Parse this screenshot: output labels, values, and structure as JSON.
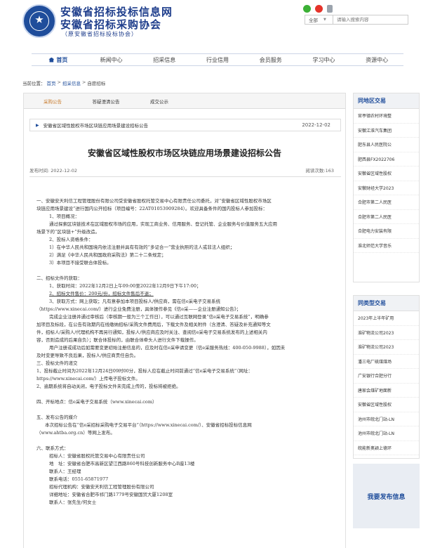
{
  "header": {
    "title_line1": "安徽省招标投标信息网",
    "title_line2": "安徽省招标采购协会",
    "title_line3": "（原安徽省招标投标协会）",
    "search_select": "全部",
    "search_placeholder": "请输入搜索内容"
  },
  "nav": [
    "首页",
    "新闻中心",
    "招采信息",
    "行业信用",
    "会员服务",
    "学习中心",
    "资源中心"
  ],
  "breadcrumb": {
    "prefix": "当前位置：",
    "items": [
      "首页",
      "招采信息",
      "自愿招标"
    ],
    "sep": ">"
  },
  "tabs": [
    "采购公告",
    "答疑澄清公告",
    "成交公示"
  ],
  "title_bar": {
    "text": "安徽省区域性股权市场区块链应用场景建设招标公告",
    "date": "2022-12-02"
  },
  "doc": {
    "title": "安徽省区域性股权市场区块链应用场景建设招标公告",
    "publish_time": "发布时间: 2022-12-02",
    "view_count": "阅读次数:163"
  },
  "content": [
    "一、安徽安天利信工程管理股份有限公司受安徽省股权托管交易中心有限责任公司委托，对“安徽省区域性股权市场区",
    "块链应用场景建设”进行国内公开招标（项目编号：22AT01053909284）。欢迎具备条件的国内投标人参加投标：",
    "1、项目概况：",
    "通过探索区块链技术在区域股权市场的应用，实现工商业务、信用服务、登记托管、企业服务与价值服务五大应用",
    "场景下的“区块链+”升级改造。",
    "2、投标人资格条件：",
    "1）在中华人民共和国境内依法注册并具有有效的“多证合一”营业执照的法人或非法人组织；",
    "2）满足《中华人民共和国政府采购法》第二十二条规定；",
    "3）本项目不接受联合体投标。",
    "二、招标文件的获取：",
    "1、获取时间：2022年12月2日上午09:00至2022年12月9日下午17:00；",
    "2、招标文件售价：200元/份，招标文件售后不退；",
    "3、获取方式：网上获取；凡有意参加本项目投标人/供应商，需在信e采电子交易系统",
    "（https://www.xinecai.com/）进行企业免费注册，具体操作参见《信e采——企业注册通知公告》；",
    "完成企业注册并通过审核后（审核期一般为三个工作日），可以通过互联网登录“信e采电子交易系统”，明确参",
    "加项目及标段，在公告有效期内在线缴纳招标/采购文件费用后，下载文件及相关附件（含澄清、答疑及补充通知等文",
    "件，招标人/采购人/代理机构不再另行通知，投标人/供应商应及时关注、查阅信e采电子交易系统发布的上述相关内",
    "容，否则造成的后果自负）；联合体投标的，由联合体牵头人进行文件下载操作。",
    "用户注册或成功后如需要变更初始注册信息的，应及时在信e采申请变更（信e采服务热线：400-050-9988），如因未",
    "及时变更导致不良后果，投标人/供应商责任自负。",
    "三、投标文件的递交",
    "1、投标截止时间为2022年12月24日09时00分，投标人应在截止时间前通过“信e采电子交易系统”（网址：",
    "https://www.xinecai.com/）上传电子投标文件。",
    "2、逾期系统将自动关闭，电子投标文件未完成上传的，投标将被拒绝。",
    "四、开标地点：信e采电子交易系统（www.xinecai.com）",
    "五、发布公告的媒介",
    "本次招标公告在“信e采招标采购电子交易平台”（https://www.xinecai.com/）、安徽省招标投标信息网",
    "（www.ahtba.org.cn）等网上发布。",
    "六、联系方式：",
    "招标人：安徽省股权托管交易中心有限责任公司",
    "地　址：安徽省合肥市高新区望江西路860号科技创新服务中心B座13楼",
    "联系人：王经理",
    "联系电话：0551-65871977",
    "招标代理机构：安徽安天利信工程管理股份有限公司",
    "详细地址：安徽省合肥市祁门路1779号安徽国贸大厦1208室",
    "联系人：张先生/何女士"
  ],
  "sidebar": {
    "box1_title": "同地区交易",
    "box1_items": [
      "官亭镇农村环境整",
      "安徽江淮汽车集团",
      "肥东县人民医院公",
      "肥西县FX2022706",
      "安徽省区域性股权",
      "安徽财经大学2023",
      "合肥市第二人民医",
      "合肥市第二人民医",
      "合肥电力安装有限",
      "淮北师范大学音乐"
    ],
    "box2_title": "同类型交易",
    "box2_items": [
      "2023年上半年矿用",
      "淮矿物流公司2023",
      "淮矿物流公司2023",
      "潘三电厂硫煤煤场",
      "广安银行合肥分行",
      "唐家会煤矿地面新",
      "安徽省区域性股权",
      "池州市皖北门站-LN",
      "池州市皖北门站-LN",
      "皖能新奥颖上德环"
    ],
    "publish": "我要发布信息"
  }
}
